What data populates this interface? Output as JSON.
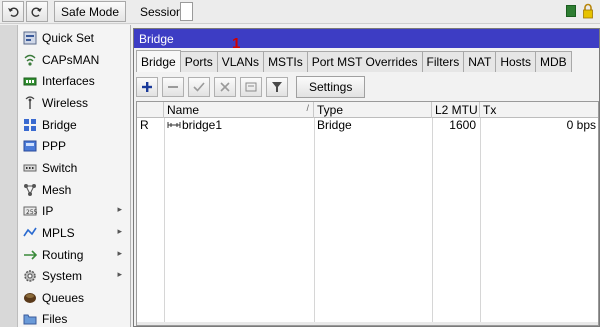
{
  "toolbar": {
    "undo_icon": "undo-icon",
    "redo_icon": "redo-icon",
    "safe_mode_label": "Safe Mode",
    "session_label": "Session:"
  },
  "sidebar": {
    "items": [
      {
        "label": "Quick Set",
        "icon": "quick-set-icon",
        "submenu": false
      },
      {
        "label": "CAPsMAN",
        "icon": "capsman-icon",
        "submenu": false
      },
      {
        "label": "Interfaces",
        "icon": "interfaces-icon",
        "submenu": false
      },
      {
        "label": "Wireless",
        "icon": "wireless-icon",
        "submenu": false
      },
      {
        "label": "Bridge",
        "icon": "bridge-icon",
        "submenu": false
      },
      {
        "label": "PPP",
        "icon": "ppp-icon",
        "submenu": false
      },
      {
        "label": "Switch",
        "icon": "switch-icon",
        "submenu": false
      },
      {
        "label": "Mesh",
        "icon": "mesh-icon",
        "submenu": false
      },
      {
        "label": "IP",
        "icon": "ip-icon",
        "submenu": true
      },
      {
        "label": "MPLS",
        "icon": "mpls-icon",
        "submenu": true
      },
      {
        "label": "Routing",
        "icon": "routing-icon",
        "submenu": true
      },
      {
        "label": "System",
        "icon": "system-icon",
        "submenu": true
      },
      {
        "label": "Queues",
        "icon": "queues-icon",
        "submenu": false
      },
      {
        "label": "Files",
        "icon": "files-icon",
        "submenu": false
      }
    ],
    "submenu_arrow": "▸"
  },
  "window": {
    "title": "Bridge",
    "annotation": "1",
    "tabs": [
      "Bridge",
      "Ports",
      "VLANs",
      "MSTIs",
      "Port MST Overrides",
      "Filters",
      "NAT",
      "Hosts",
      "MDB"
    ],
    "active_tab": "Bridge",
    "settings_label": "Settings"
  },
  "table": {
    "columns": [
      "",
      "Name",
      "Type",
      "L2 MTU",
      "Tx"
    ],
    "rows": [
      {
        "flag": "R",
        "name": "bridge1",
        "type": "Bridge",
        "l2mtu": "1600",
        "tx": "0 bps"
      }
    ]
  },
  "colors": {
    "title_bar": "#3d3dc4",
    "annotation": "#d10000",
    "status_green": "#2e7d32"
  }
}
